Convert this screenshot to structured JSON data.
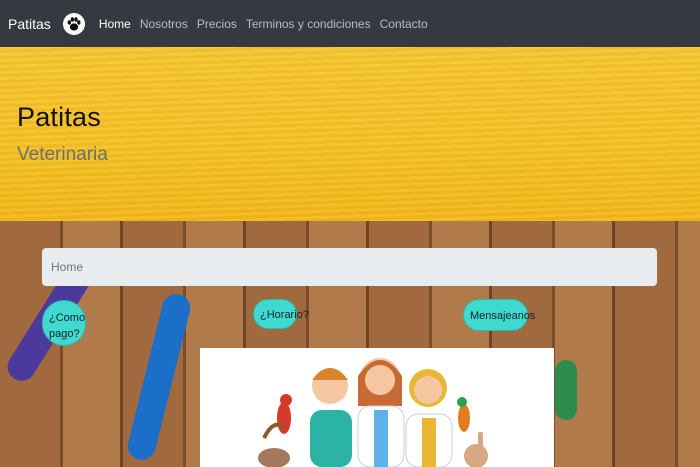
{
  "navbar": {
    "brand": "Patitas",
    "links": [
      {
        "label": "Home",
        "active": true
      },
      {
        "label": "Nosotros",
        "active": false
      },
      {
        "label": "Precios",
        "active": false
      },
      {
        "label": "Terminos y condiciones",
        "active": false
      },
      {
        "label": "Contacto",
        "active": false
      }
    ]
  },
  "hero": {
    "title": "Patitas",
    "subtitle": "Veterinaria"
  },
  "breadcrumb": {
    "current": "Home"
  },
  "buttons": {
    "pago_line1": "¿Como",
    "pago_line2": "pago?",
    "horario": "¿Horario?",
    "mensaje": "Mensajeanos"
  },
  "colors": {
    "navbar": "#343a40",
    "hero": "#f5c124",
    "button": "#3fd9cf",
    "breadcrumb": "#e9ecef"
  },
  "icons": {
    "brand_icon": "paw-icon"
  }
}
